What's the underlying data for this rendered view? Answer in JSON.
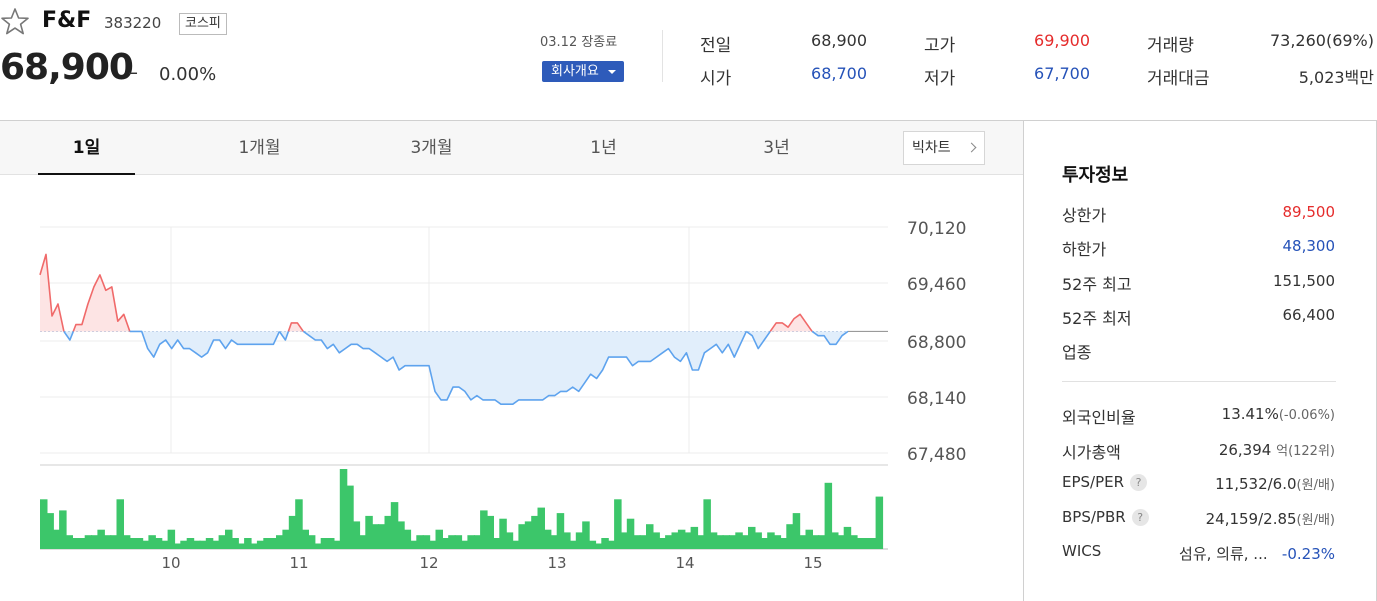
{
  "header": {
    "name": "F&F",
    "code": "383220",
    "market": "코스피",
    "price": "68,900",
    "change_mark": "–",
    "change_rate": "0.00%",
    "session": "03.12 장종료",
    "company_button": "회사개요"
  },
  "quote": {
    "prev_label": "전일",
    "prev": "68,900",
    "open_label": "시가",
    "open": "68,700",
    "high_label": "고가",
    "high": "69,900",
    "low_label": "저가",
    "low": "67,700",
    "volume_label": "거래량",
    "volume": "73,260(69%)",
    "amount_label": "거래대금",
    "amount": "5,023백만"
  },
  "tabs": [
    "1일",
    "1개월",
    "3개월",
    "1년",
    "3년"
  ],
  "active_tab": "1일",
  "big_chart_label": "빅차트",
  "info": {
    "title": "투자정보",
    "upper_limit_label": "상한가",
    "upper_limit": "89,500",
    "lower_limit_label": "하한가",
    "lower_limit": "48,300",
    "high52_label": "52주 최고",
    "high52": "151,500",
    "low52_label": "52주 최저",
    "low52": "66,400",
    "industry_label": "업종",
    "foreign_label": "외국인비율",
    "foreign": "13.41%",
    "foreign_change": "(-0.06%)",
    "cap_label": "시가총액",
    "cap": "26,394",
    "cap_unit": "억(122위)",
    "eps_label": "EPS/PER",
    "eps": "11,532/6.0",
    "eps_unit": "(원/배)",
    "bps_label": "BPS/PBR",
    "bps": "24,159/2.85",
    "bps_unit": "(원/배)",
    "wics_label": "WICS",
    "wics": "섬유, 의류, ...",
    "wics_change": "-0.23%",
    "help_mark": "?"
  },
  "colors": {
    "up": "#e52c2c",
    "down": "#2552b8",
    "line_up": "#f06a6a",
    "line_down": "#5ea3ee",
    "fill_up": "#fde4e4",
    "fill_down": "#e1eefb",
    "volume": "#3cc66a"
  },
  "chart_data": {
    "type": "line",
    "base": 68900,
    "y_ticks": [
      "70,120",
      "69,460",
      "68,800",
      "68,140",
      "67,480"
    ],
    "ylim": [
      67480,
      70120
    ],
    "x_ticks": [
      "10",
      "11",
      "12",
      "13",
      "14",
      "15"
    ],
    "price": [
      69560,
      69800,
      69080,
      69220,
      68900,
      68800,
      68980,
      68980,
      69220,
      69420,
      69560,
      69380,
      69420,
      69020,
      69100,
      68900,
      68900,
      68900,
      68700,
      68600,
      68750,
      68800,
      68700,
      68800,
      68700,
      68700,
      68650,
      68600,
      68650,
      68800,
      68800,
      68700,
      68800,
      68750,
      68750,
      68750,
      68750,
      68750,
      68750,
      68750,
      68900,
      68800,
      69000,
      69000,
      68900,
      68850,
      68800,
      68800,
      68700,
      68750,
      68650,
      68700,
      68750,
      68750,
      68700,
      68700,
      68650,
      68600,
      68550,
      68600,
      68450,
      68500,
      68500,
      68500,
      68500,
      68500,
      68200,
      68100,
      68100,
      68250,
      68250,
      68200,
      68100,
      68150,
      68100,
      68100,
      68100,
      68050,
      68050,
      68050,
      68100,
      68100,
      68100,
      68100,
      68100,
      68150,
      68150,
      68200,
      68200,
      68250,
      68200,
      68300,
      68400,
      68350,
      68450,
      68600,
      68600,
      68600,
      68600,
      68500,
      68550,
      68550,
      68550,
      68600,
      68650,
      68700,
      68600,
      68550,
      68650,
      68450,
      68450,
      68650,
      68700,
      68750,
      68650,
      68750,
      68600,
      68750,
      68900,
      68850,
      68700,
      68800,
      68900,
      69000,
      69000,
      68950,
      69050,
      69100,
      69000,
      68900,
      68850,
      68850,
      68750,
      68750,
      68850,
      68900
    ],
    "volume": [
      18,
      13,
      7,
      14,
      5,
      4,
      4,
      5,
      5,
      7,
      5,
      5,
      18,
      5,
      4,
      4,
      3,
      5,
      4,
      3,
      7,
      2,
      3,
      4,
      3,
      3,
      4,
      3,
      5,
      7,
      4,
      2,
      4,
      2,
      3,
      4,
      4,
      5,
      7,
      12,
      18,
      7,
      5,
      2,
      4,
      4,
      3,
      29,
      23,
      10,
      5,
      12,
      9,
      9,
      12,
      17,
      10,
      7,
      3,
      5,
      5,
      3,
      7,
      4,
      5,
      5,
      3,
      5,
      5,
      14,
      12,
      4,
      11,
      6,
      3,
      9,
      10,
      12,
      15,
      7,
      5,
      13,
      6,
      3,
      6,
      10,
      3,
      2,
      4,
      3,
      18,
      6,
      11,
      5,
      5,
      9,
      6,
      4,
      5,
      6,
      7,
      6,
      8,
      5,
      18,
      6,
      5,
      5,
      5,
      6,
      5,
      8,
      6,
      4,
      6,
      5,
      4,
      9,
      13,
      5,
      7,
      5,
      5,
      24,
      6,
      5,
      8,
      5,
      4,
      4,
      4,
      19
    ]
  }
}
